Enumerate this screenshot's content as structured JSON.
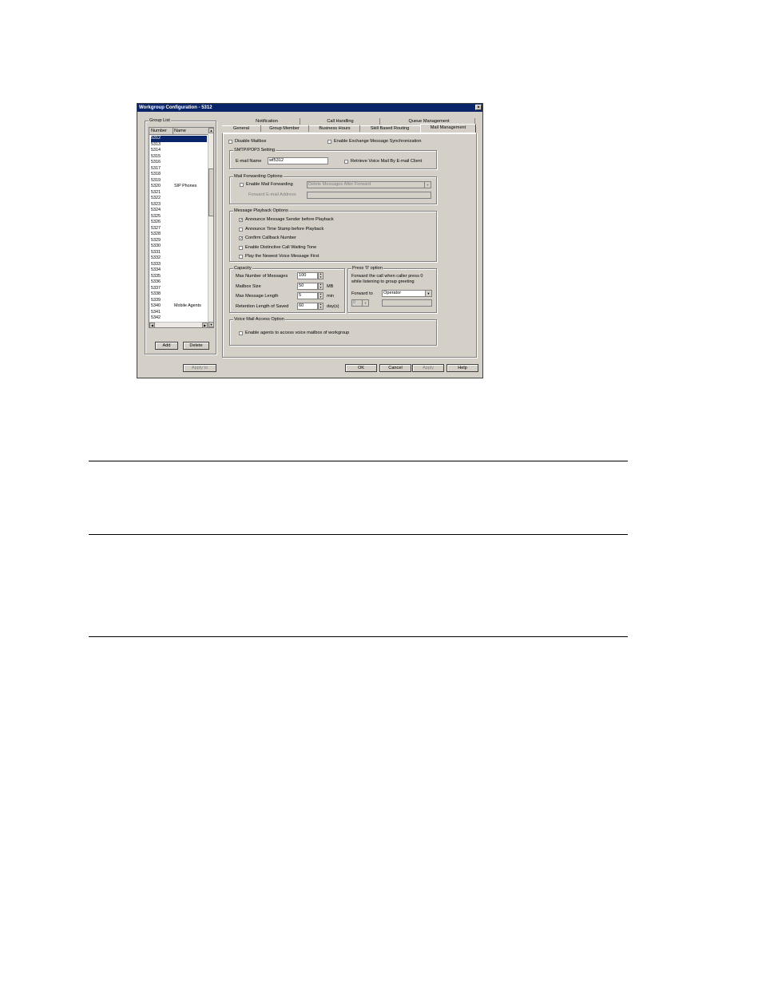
{
  "window": {
    "title": "Workgroup Configuration - 5312",
    "close": "×"
  },
  "group_list": {
    "legend": "Group List",
    "headers": [
      "Number",
      "Name"
    ],
    "rows": [
      {
        "number": "5312",
        "name": ""
      },
      {
        "number": "5313",
        "name": ""
      },
      {
        "number": "5314",
        "name": ""
      },
      {
        "number": "5315",
        "name": ""
      },
      {
        "number": "5316",
        "name": ""
      },
      {
        "number": "5317",
        "name": ""
      },
      {
        "number": "5318",
        "name": ""
      },
      {
        "number": "5319",
        "name": ""
      },
      {
        "number": "5320",
        "name": "SIP Phones"
      },
      {
        "number": "5321",
        "name": ""
      },
      {
        "number": "5322",
        "name": ""
      },
      {
        "number": "5323",
        "name": ""
      },
      {
        "number": "5324",
        "name": ""
      },
      {
        "number": "5325",
        "name": ""
      },
      {
        "number": "5326",
        "name": ""
      },
      {
        "number": "5327",
        "name": ""
      },
      {
        "number": "5328",
        "name": ""
      },
      {
        "number": "5329",
        "name": ""
      },
      {
        "number": "5330",
        "name": ""
      },
      {
        "number": "5331",
        "name": ""
      },
      {
        "number": "5332",
        "name": ""
      },
      {
        "number": "5333",
        "name": ""
      },
      {
        "number": "5334",
        "name": ""
      },
      {
        "number": "5335",
        "name": ""
      },
      {
        "number": "5336",
        "name": ""
      },
      {
        "number": "5337",
        "name": ""
      },
      {
        "number": "5338",
        "name": ""
      },
      {
        "number": "5339",
        "name": ""
      },
      {
        "number": "5340",
        "name": "Mobile Agents"
      },
      {
        "number": "5341",
        "name": ""
      },
      {
        "number": "5342",
        "name": ""
      },
      {
        "number": "5343",
        "name": ""
      },
      {
        "number": "5344",
        "name": ""
      },
      {
        "number": "5345",
        "name": ""
      }
    ],
    "selected_index": 0,
    "add_label": "Add",
    "delete_label": "Delete"
  },
  "tabs": {
    "back_row": [
      "Notification",
      "Call Handling",
      "Queue Management"
    ],
    "front_row": [
      "General",
      "Group Member",
      "Business Hours",
      "Skill Based Routing",
      "Mail Management"
    ],
    "active": "Mail Management"
  },
  "mail": {
    "disable_mailbox": {
      "label": "Disable Mailbox",
      "checked": false
    },
    "exchange_sync": {
      "label": "Enable Exchange Message Synchronization",
      "checked": false
    },
    "smtp": {
      "legend": "SMTP/POP3 Setting",
      "email_label": "E-mail Name",
      "email_value": "wf5312",
      "retrieve": {
        "label": "Retrieve Voice Mail By E-mail Client",
        "checked": false
      }
    },
    "forwarding": {
      "legend": "Mail Forwarding Options",
      "enable": {
        "label": "Enable Mail Forwarding",
        "checked": false
      },
      "action_value": "Delete Messages After Forward",
      "address_label": "Forward E-mail Address",
      "address_value": ""
    },
    "playback": {
      "legend": "Message Playback Options",
      "options": [
        {
          "label": "Announce Message Sender before Playback",
          "checked": true
        },
        {
          "label": "Announce Time Stamp before Playback",
          "checked": false
        },
        {
          "label": "Confirm Callback Number",
          "checked": true
        },
        {
          "label": "Enable Distinctive Call Waiting Tone",
          "checked": false
        },
        {
          "label": "Play the Newest Voice Message First",
          "checked": false
        }
      ]
    },
    "capacity": {
      "legend": "Capacity",
      "max_messages": {
        "label": "Max Number of Messages",
        "value": "100",
        "unit": ""
      },
      "mailbox_size": {
        "label": "Mailbox Size",
        "value": "50",
        "unit": "MB"
      },
      "max_length": {
        "label": "Max Message Length",
        "value": "5",
        "unit": "min"
      },
      "retention": {
        "label": "Retention Length of Saved",
        "value": "60",
        "unit": "day(s)"
      }
    },
    "press0": {
      "legend": "Press '0' option",
      "desc_line1": "Forward the call when caller press 0",
      "desc_line2": "while listening to group greeting",
      "forward_label": "Forward to",
      "forward_value": "Operator",
      "digit_value": "0",
      "target_value": ""
    },
    "access": {
      "legend": "Voice Mail Access Option",
      "enable": {
        "label": "Enable agents to access voice mailbox of workgroup",
        "checked": false
      }
    }
  },
  "buttons": {
    "apply_to": "Apply to",
    "ok": "OK",
    "cancel": "Cancel",
    "apply": "Apply",
    "help": "Help"
  }
}
